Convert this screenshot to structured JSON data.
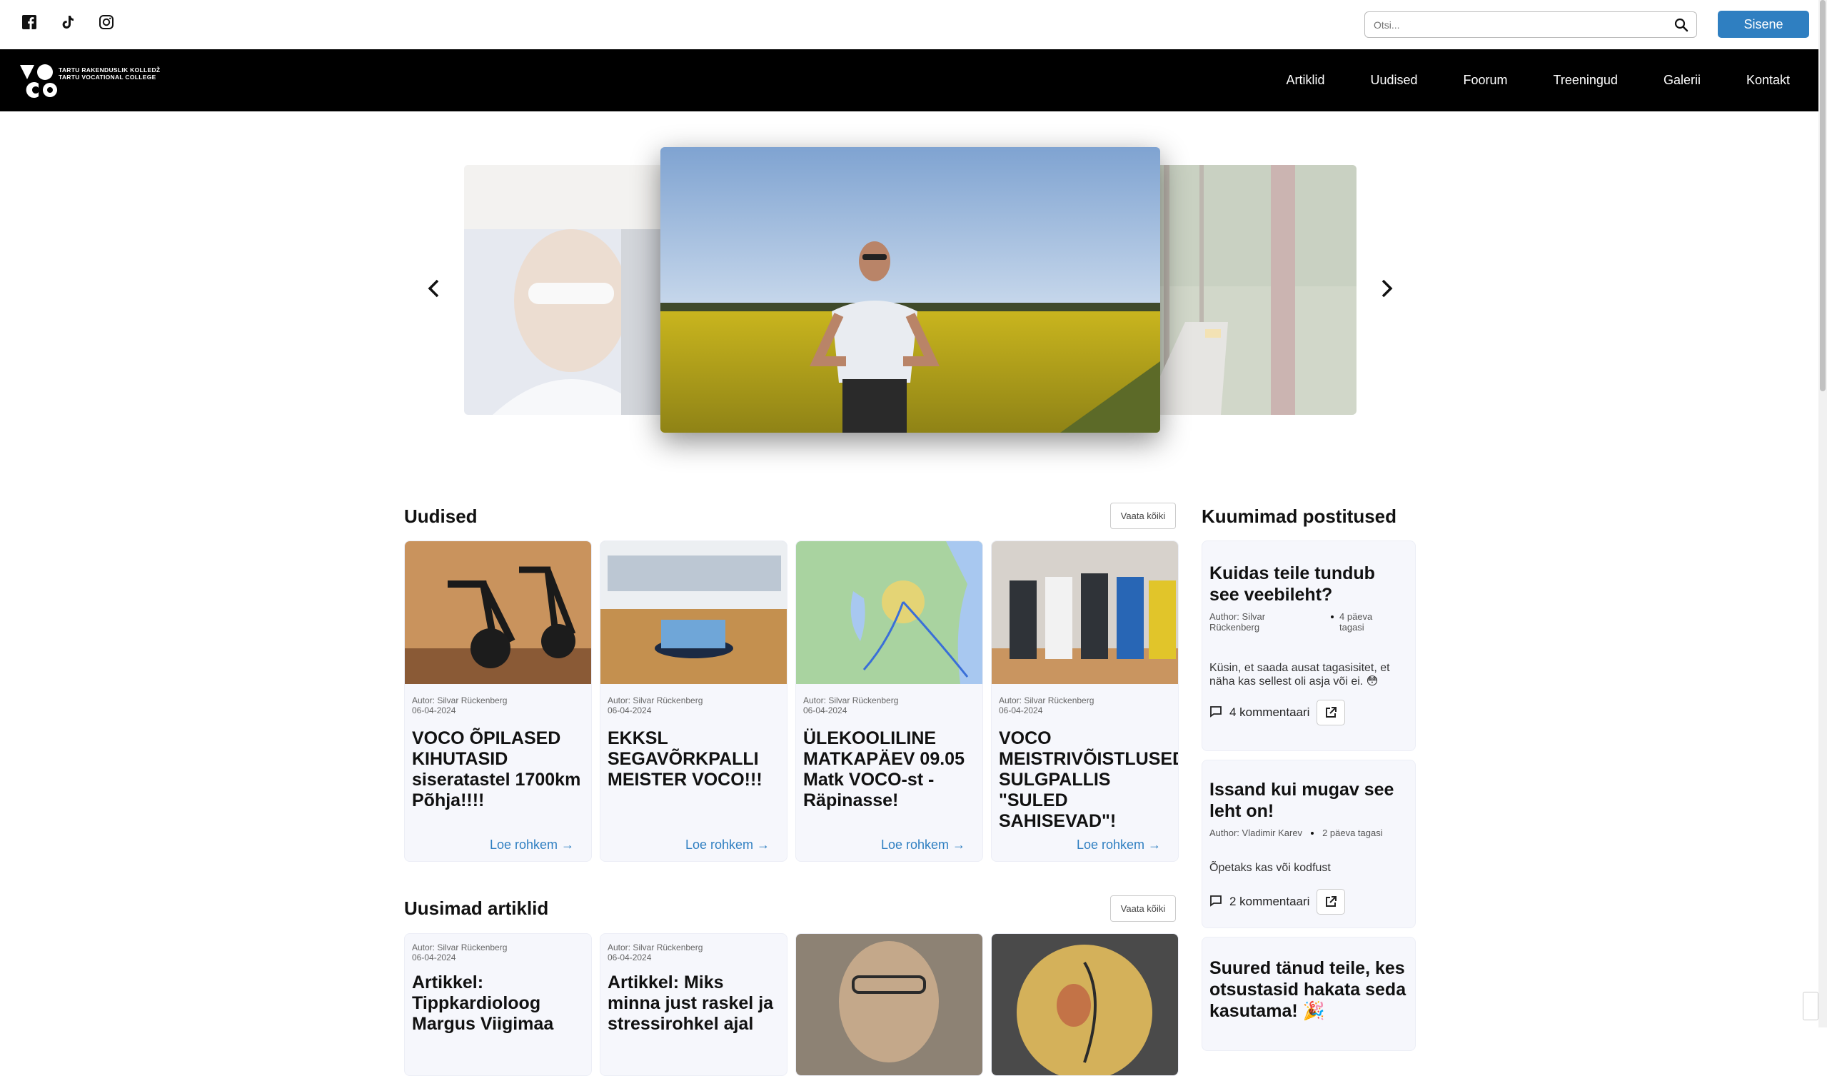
{
  "topbar": {
    "search_placeholder": "Otsi...",
    "login_label": "Sisene"
  },
  "logo": {
    "line1": "TARTU RAKENDUSLIK KOLLEDŽ",
    "line2": "TARTU VOCATIONAL COLLEGE"
  },
  "nav": {
    "items": [
      "Artiklid",
      "Uudised",
      "Foorum",
      "Treeningud",
      "Galerii",
      "Kontakt"
    ]
  },
  "news": {
    "title": "Uudised",
    "see_all": "Vaata kõiki",
    "cards": [
      {
        "author": "Autor: Silvar Rückenberg",
        "date": "06-04-2024",
        "title": "VOCO ÕPILASED KIHUTASID siseratastel 1700km Põhja!!!!",
        "more": "Loe rohkem →"
      },
      {
        "author": "Autor: Silvar Rückenberg",
        "date": "06-04-2024",
        "title": "EKKSL SEGAVÕRKPALLI MEISTER VOCO!!!",
        "more": "Loe rohkem →"
      },
      {
        "author": "Autor: Silvar Rückenberg",
        "date": "06-04-2024",
        "title": "ÜLEKOOLILINE MATKAPÄEV 09.05 Matk VOCO-st - Räpinasse!",
        "more": "Loe rohkem →"
      },
      {
        "author": "Autor: Silvar Rückenberg",
        "date": "06-04-2024",
        "title": "VOCO MEISTRIVÕISTLUSED SULGPALLIS \"SULED SAHISEVAD\"!",
        "more": "Loe rohkem →"
      }
    ]
  },
  "articles": {
    "title": "Uusimad artiklid",
    "see_all": "Vaata kõiki",
    "cards": [
      {
        "author": "Autor: Silvar Rückenberg",
        "date": "06-04-2024",
        "title": "Artikkel: Tippkardioloog Margus Viigimaa"
      },
      {
        "author": "Autor: Silvar Rückenberg",
        "date": "06-04-2024",
        "title": "Artikkel: Miks minna just raskel ja stressirohkel ajal"
      }
    ]
  },
  "hot": {
    "title": "Kuumimad postitused",
    "posts": [
      {
        "title": "Kuidas teile tundub see veebileht?",
        "author": "Author: Silvar Rückenberg",
        "time": "4 päeva tagasi",
        "body": "Küsin, et saada ausat tagasisitet, et näha kas sellest oli asja või ei. 😳",
        "comments": "4 kommentaari"
      },
      {
        "title": "Issand kui mugav see leht on!",
        "author": "Author: Vladimir Karev",
        "time": "2 päeva tagasi",
        "body": "Õpetaks kas või kodfust",
        "comments": "2 kommentaari"
      },
      {
        "title": "Suured tänud teile, kes otsustasid hakata seda kasutama! 🎉"
      }
    ]
  },
  "colors": {
    "accent": "#2f7fc1",
    "navbar": "#000000",
    "card_bg": "#f6f7fc"
  }
}
